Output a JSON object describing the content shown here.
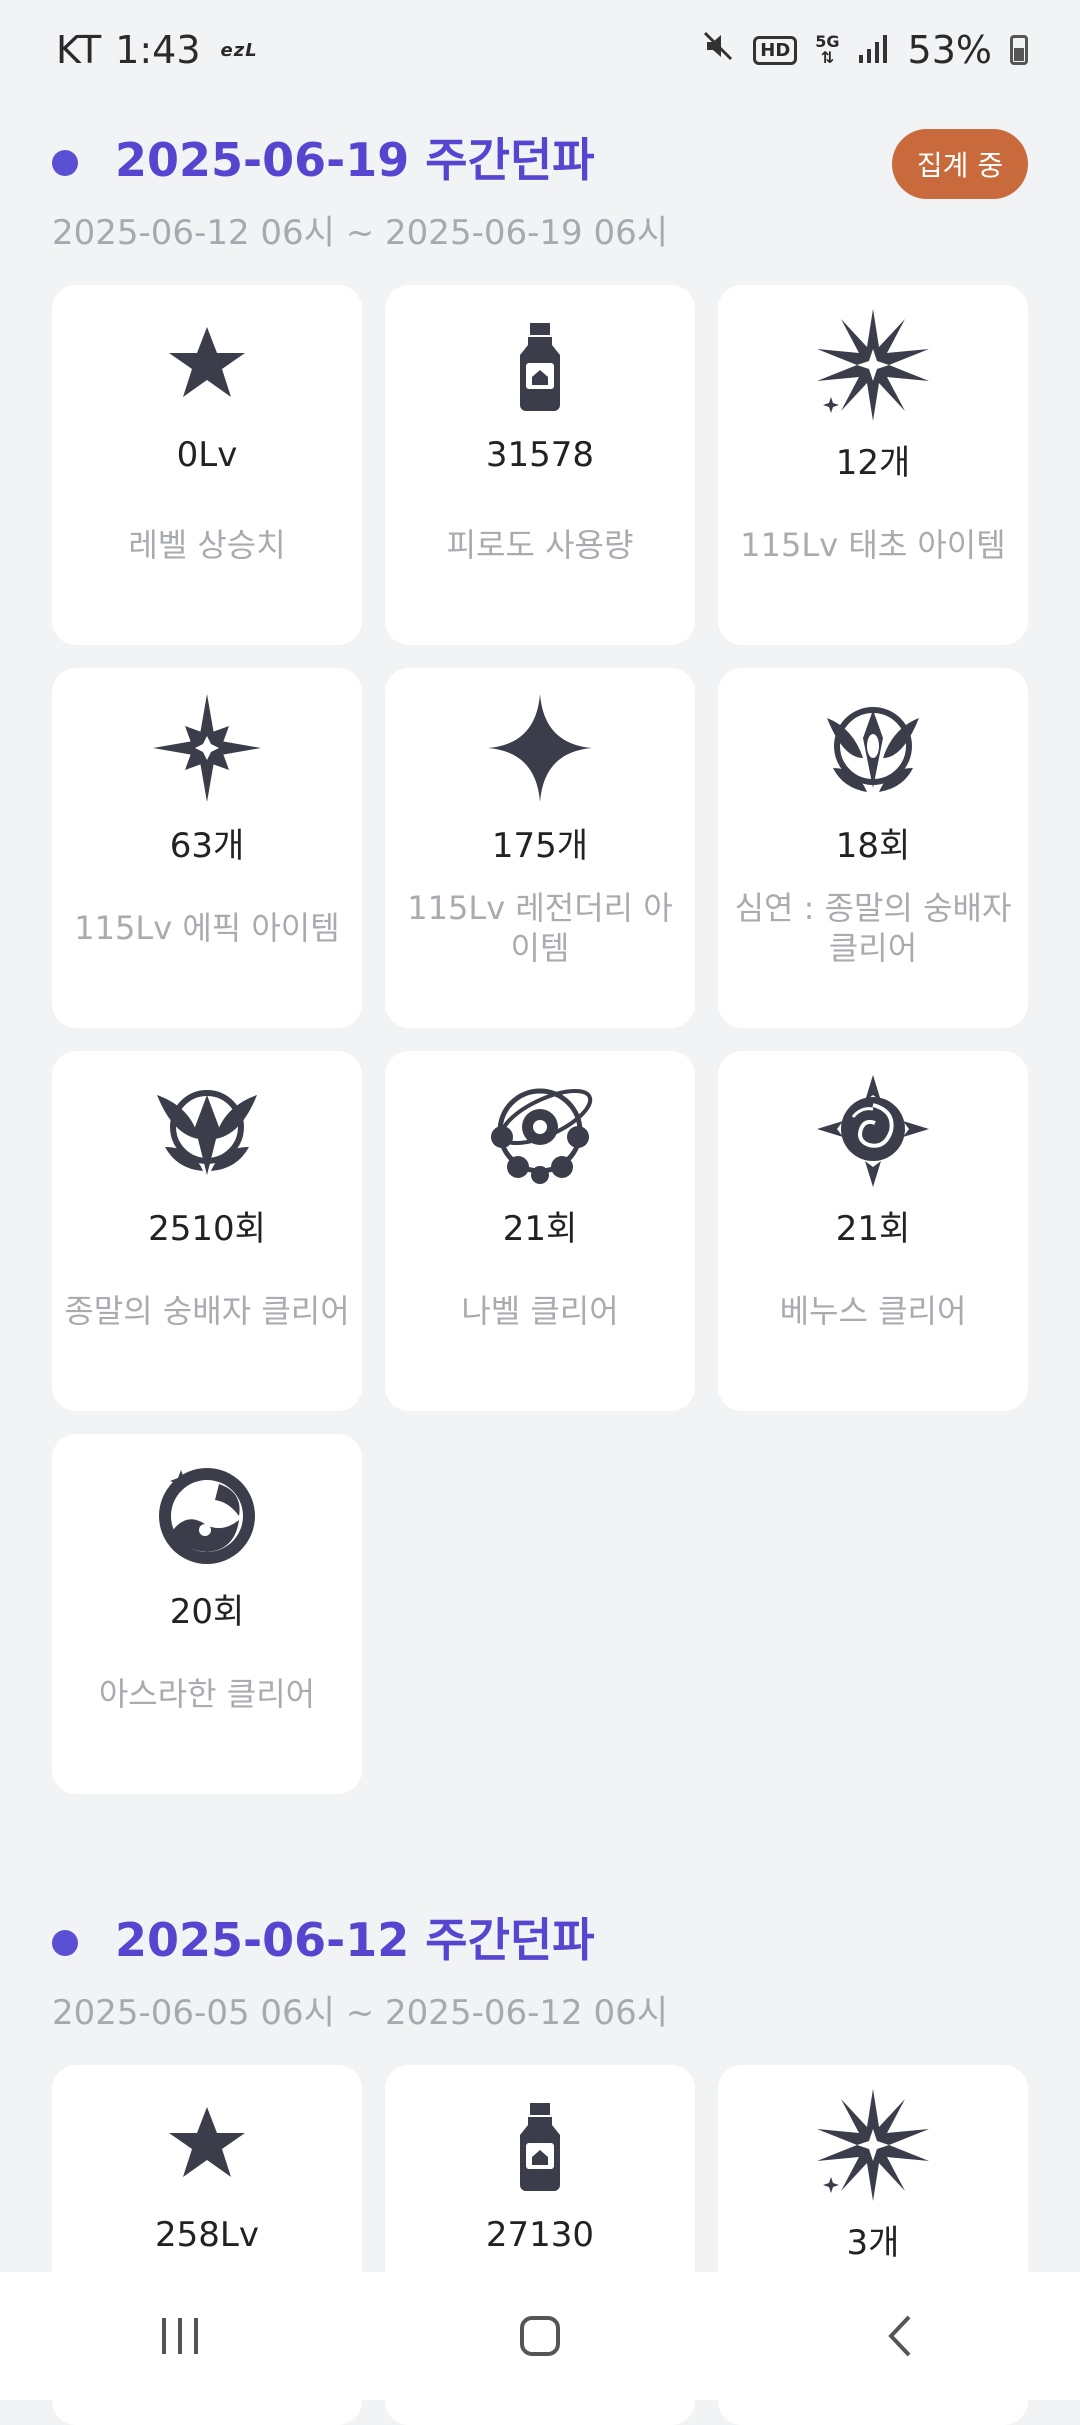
{
  "status_bar": {
    "carrier": "KT",
    "time": "1:43",
    "app_tag": "ezL",
    "hd": "HD",
    "network": "5G",
    "battery": "53%"
  },
  "sections": [
    {
      "title": "2025-06-19 주간던파",
      "range": "2025-06-12 06시 ~ 2025-06-19 06시",
      "badge": "집계 중",
      "cards": [
        {
          "icon": "star-icon",
          "value": "0Lv",
          "label": "레벨 상승치"
        },
        {
          "icon": "potion-bottle-icon",
          "value": "31578",
          "label": "피로도 사용량"
        },
        {
          "icon": "burst-spark-icon",
          "value": "12개",
          "label": "115Lv 태초 아이템"
        },
        {
          "icon": "four-point-star-ornate-icon",
          "value": "63개",
          "label": "115Lv 에픽 아이템"
        },
        {
          "icon": "four-point-star-icon",
          "value": "175개",
          "label": "115Lv 레전더리 아이템"
        },
        {
          "icon": "abyss-emblem-icon",
          "value": "18회",
          "label": "심연 : 종말의 숭배자 클리어"
        },
        {
          "icon": "worshipper-emblem-icon",
          "value": "2510회",
          "label": "종말의 숭배자 클리어"
        },
        {
          "icon": "nabel-emblem-icon",
          "value": "21회",
          "label": "나벨 클리어"
        },
        {
          "icon": "venus-rose-emblem-icon",
          "value": "21회",
          "label": "베누스 클리어"
        },
        {
          "icon": "asrahan-emblem-icon",
          "value": "20회",
          "label": "아스라한 클리어"
        }
      ]
    },
    {
      "title": "2025-06-12 주간던파",
      "range": "2025-06-05 06시 ~ 2025-06-12 06시",
      "cards": [
        {
          "icon": "star-icon",
          "value": "258Lv",
          "label": ""
        },
        {
          "icon": "potion-bottle-icon",
          "value": "27130",
          "label": ""
        },
        {
          "icon": "burst-spark-icon",
          "value": "3개",
          "label": ""
        }
      ]
    }
  ],
  "colors": {
    "accent": "#5545cf",
    "badge": "#c96a3c",
    "icon": "#3b3d4a",
    "background": "#f2f3f5"
  }
}
